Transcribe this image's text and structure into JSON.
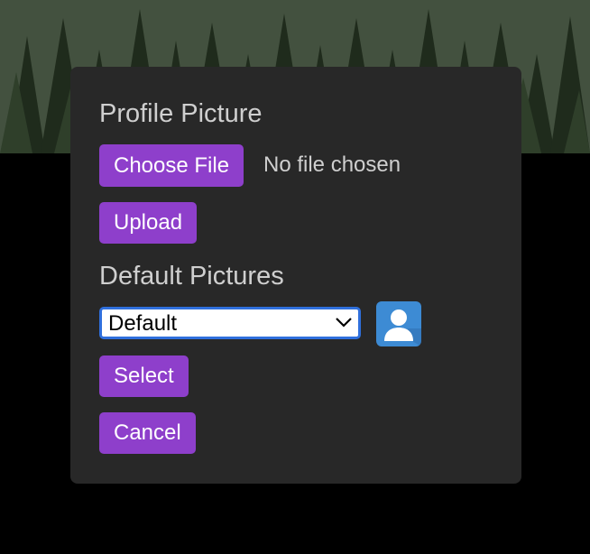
{
  "profile_section": {
    "title": "Profile Picture",
    "choose_file_label": "Choose File",
    "file_status": "No file chosen",
    "upload_label": "Upload"
  },
  "default_section": {
    "title": "Default Pictures",
    "selected_option": "Default",
    "select_label": "Select",
    "cancel_label": "Cancel"
  },
  "icons": {
    "avatar": "user-silhouette-icon",
    "chevron": "chevron-down-icon"
  },
  "colors": {
    "button": "#8e3fcb",
    "modal_bg": "#282828",
    "select_border": "#2f6fdc",
    "avatar_bg": "#3d8bd4"
  }
}
